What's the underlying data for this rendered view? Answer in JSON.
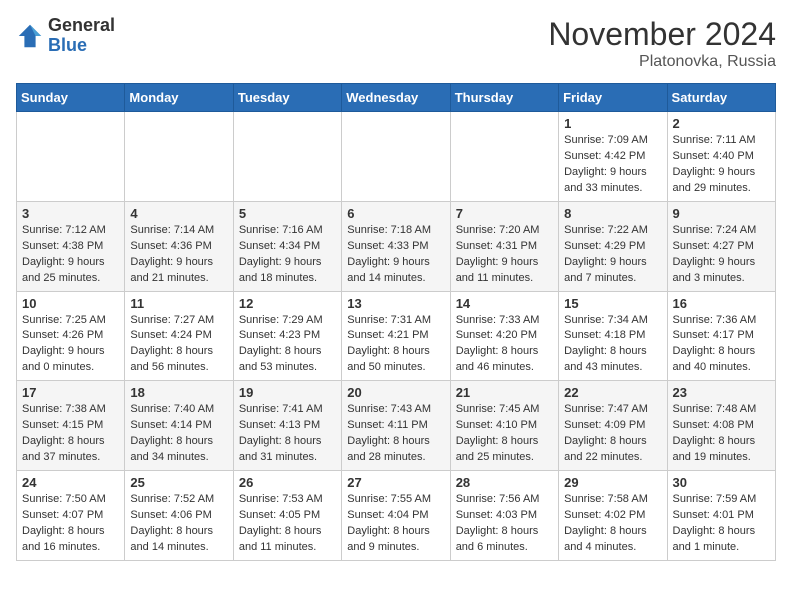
{
  "logo": {
    "general": "General",
    "blue": "Blue"
  },
  "title": "November 2024",
  "location": "Platonovka, Russia",
  "days_of_week": [
    "Sunday",
    "Monday",
    "Tuesday",
    "Wednesday",
    "Thursday",
    "Friday",
    "Saturday"
  ],
  "weeks": [
    [
      {
        "day": "",
        "detail": ""
      },
      {
        "day": "",
        "detail": ""
      },
      {
        "day": "",
        "detail": ""
      },
      {
        "day": "",
        "detail": ""
      },
      {
        "day": "",
        "detail": ""
      },
      {
        "day": "1",
        "detail": "Sunrise: 7:09 AM\nSunset: 4:42 PM\nDaylight: 9 hours\nand 33 minutes."
      },
      {
        "day": "2",
        "detail": "Sunrise: 7:11 AM\nSunset: 4:40 PM\nDaylight: 9 hours\nand 29 minutes."
      }
    ],
    [
      {
        "day": "3",
        "detail": "Sunrise: 7:12 AM\nSunset: 4:38 PM\nDaylight: 9 hours\nand 25 minutes."
      },
      {
        "day": "4",
        "detail": "Sunrise: 7:14 AM\nSunset: 4:36 PM\nDaylight: 9 hours\nand 21 minutes."
      },
      {
        "day": "5",
        "detail": "Sunrise: 7:16 AM\nSunset: 4:34 PM\nDaylight: 9 hours\nand 18 minutes."
      },
      {
        "day": "6",
        "detail": "Sunrise: 7:18 AM\nSunset: 4:33 PM\nDaylight: 9 hours\nand 14 minutes."
      },
      {
        "day": "7",
        "detail": "Sunrise: 7:20 AM\nSunset: 4:31 PM\nDaylight: 9 hours\nand 11 minutes."
      },
      {
        "day": "8",
        "detail": "Sunrise: 7:22 AM\nSunset: 4:29 PM\nDaylight: 9 hours\nand 7 minutes."
      },
      {
        "day": "9",
        "detail": "Sunrise: 7:24 AM\nSunset: 4:27 PM\nDaylight: 9 hours\nand 3 minutes."
      }
    ],
    [
      {
        "day": "10",
        "detail": "Sunrise: 7:25 AM\nSunset: 4:26 PM\nDaylight: 9 hours\nand 0 minutes."
      },
      {
        "day": "11",
        "detail": "Sunrise: 7:27 AM\nSunset: 4:24 PM\nDaylight: 8 hours\nand 56 minutes."
      },
      {
        "day": "12",
        "detail": "Sunrise: 7:29 AM\nSunset: 4:23 PM\nDaylight: 8 hours\nand 53 minutes."
      },
      {
        "day": "13",
        "detail": "Sunrise: 7:31 AM\nSunset: 4:21 PM\nDaylight: 8 hours\nand 50 minutes."
      },
      {
        "day": "14",
        "detail": "Sunrise: 7:33 AM\nSunset: 4:20 PM\nDaylight: 8 hours\nand 46 minutes."
      },
      {
        "day": "15",
        "detail": "Sunrise: 7:34 AM\nSunset: 4:18 PM\nDaylight: 8 hours\nand 43 minutes."
      },
      {
        "day": "16",
        "detail": "Sunrise: 7:36 AM\nSunset: 4:17 PM\nDaylight: 8 hours\nand 40 minutes."
      }
    ],
    [
      {
        "day": "17",
        "detail": "Sunrise: 7:38 AM\nSunset: 4:15 PM\nDaylight: 8 hours\nand 37 minutes."
      },
      {
        "day": "18",
        "detail": "Sunrise: 7:40 AM\nSunset: 4:14 PM\nDaylight: 8 hours\nand 34 minutes."
      },
      {
        "day": "19",
        "detail": "Sunrise: 7:41 AM\nSunset: 4:13 PM\nDaylight: 8 hours\nand 31 minutes."
      },
      {
        "day": "20",
        "detail": "Sunrise: 7:43 AM\nSunset: 4:11 PM\nDaylight: 8 hours\nand 28 minutes."
      },
      {
        "day": "21",
        "detail": "Sunrise: 7:45 AM\nSunset: 4:10 PM\nDaylight: 8 hours\nand 25 minutes."
      },
      {
        "day": "22",
        "detail": "Sunrise: 7:47 AM\nSunset: 4:09 PM\nDaylight: 8 hours\nand 22 minutes."
      },
      {
        "day": "23",
        "detail": "Sunrise: 7:48 AM\nSunset: 4:08 PM\nDaylight: 8 hours\nand 19 minutes."
      }
    ],
    [
      {
        "day": "24",
        "detail": "Sunrise: 7:50 AM\nSunset: 4:07 PM\nDaylight: 8 hours\nand 16 minutes."
      },
      {
        "day": "25",
        "detail": "Sunrise: 7:52 AM\nSunset: 4:06 PM\nDaylight: 8 hours\nand 14 minutes."
      },
      {
        "day": "26",
        "detail": "Sunrise: 7:53 AM\nSunset: 4:05 PM\nDaylight: 8 hours\nand 11 minutes."
      },
      {
        "day": "27",
        "detail": "Sunrise: 7:55 AM\nSunset: 4:04 PM\nDaylight: 8 hours\nand 9 minutes."
      },
      {
        "day": "28",
        "detail": "Sunrise: 7:56 AM\nSunset: 4:03 PM\nDaylight: 8 hours\nand 6 minutes."
      },
      {
        "day": "29",
        "detail": "Sunrise: 7:58 AM\nSunset: 4:02 PM\nDaylight: 8 hours\nand 4 minutes."
      },
      {
        "day": "30",
        "detail": "Sunrise: 7:59 AM\nSunset: 4:01 PM\nDaylight: 8 hours\nand 1 minute."
      }
    ]
  ]
}
